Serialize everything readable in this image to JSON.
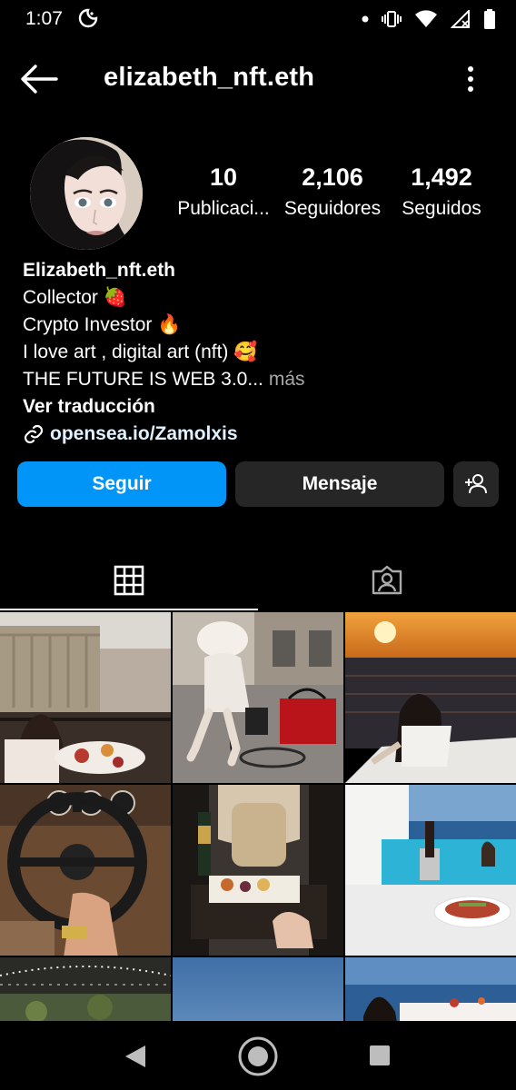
{
  "status_bar": {
    "time": "1:07"
  },
  "header": {
    "username": "elizabeth_nft.eth"
  },
  "profile": {
    "stats": [
      {
        "count": "10",
        "label": "Publicaci..."
      },
      {
        "count": "2,106",
        "label": "Seguidores"
      },
      {
        "count": "1,492",
        "label": "Seguidos"
      }
    ],
    "bio": {
      "name": "Elizabeth_nft.eth",
      "line1": "Collector 🍓",
      "line2": "Crypto Investor 🔥",
      "line3": "I love art , digital art (nft) 🥰",
      "line4": "THE FUTURE IS WEB 3.0...",
      "more": "más",
      "translate": "Ver traducción",
      "link": "opensea.io/Zamolxis"
    }
  },
  "actions": {
    "follow": "Seguir",
    "message": "Mensaje"
  },
  "colors": {
    "accent": "#0095f6",
    "button_dark": "#262626"
  },
  "tabs": [
    {
      "icon": "grid-icon",
      "active": true
    },
    {
      "icon": "tagged-icon",
      "active": false
    }
  ],
  "posts": [
    {
      "icon": "photo-breakfast-balcony-paris"
    },
    {
      "icon": "photo-woman-roses-cartier-bag"
    },
    {
      "icon": "photo-sunset-yacht"
    },
    {
      "icon": "photo-rolls-royce-steering-wheel"
    },
    {
      "icon": "photo-private-jet-champagne"
    },
    {
      "icon": "photo-santorini-pool"
    },
    {
      "icon": "photo-night-lights"
    },
    {
      "icon": "photo-blue-sky"
    },
    {
      "icon": "photo-sea-view"
    }
  ]
}
